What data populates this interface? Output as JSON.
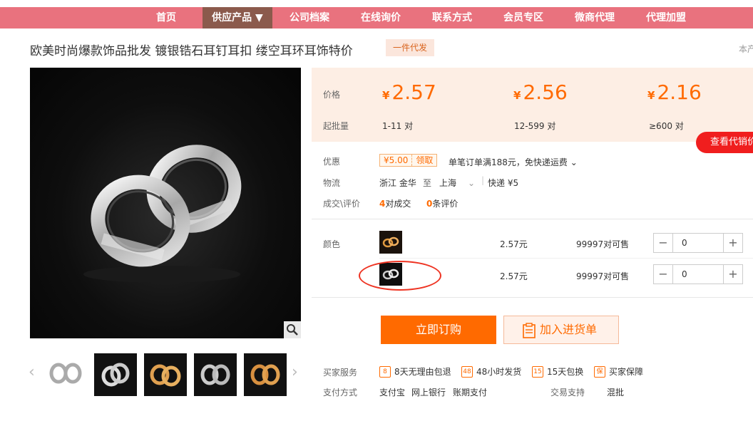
{
  "nav": [
    "首页",
    "供应产品 ▼",
    "公司档案",
    "在线询价",
    "联系方式",
    "会员专区",
    "微商代理",
    "代理加盟"
  ],
  "product": {
    "title": "欧美时尚爆款饰品批发 镀银锆石耳钉耳扣 缕空耳环耳饰特价",
    "badge": "一件代发",
    "corner_text": "本产"
  },
  "pricing": {
    "price_label": "价格",
    "min_label": "起批量",
    "currency": "¥",
    "tiers": [
      {
        "price": "2.57",
        "range": "1-11",
        "unit": "对"
      },
      {
        "price": "2.56",
        "range": "12-599",
        "unit": "对"
      },
      {
        "price": "2.16",
        "range": "≥600",
        "unit": "对"
      }
    ]
  },
  "agent_button": "查看代销价",
  "promo": {
    "label": "优惠",
    "coupon_amount": "¥5.00",
    "coupon_action": "领取",
    "text": "单笔订单满188元，免快递运费"
  },
  "logistics": {
    "label": "物流",
    "from": "浙江 金华",
    "to_word": "至",
    "to": "上海",
    "express": "快递 ¥5"
  },
  "deals": {
    "label": "成交\\评价",
    "count": "4",
    "count_text": "对成交",
    "reviews": "0",
    "reviews_text": "条评价"
  },
  "color_label": "颜色",
  "variants": [
    {
      "price": "2.57元",
      "stock": "99997对可售",
      "qty": "0"
    },
    {
      "price": "2.57元",
      "stock": "99997对可售",
      "qty": "0"
    }
  ],
  "buttons": {
    "buy": "立即订购",
    "cart": "加入进货单"
  },
  "services": {
    "label": "买家服务",
    "items": [
      "8天无理由包退",
      "48小时发货",
      "15天包换",
      "买家保障"
    ]
  },
  "payment": {
    "label": "支付方式",
    "methods": [
      "支付宝",
      "网上银行",
      "账期支付"
    ],
    "trade_label": "交易支持",
    "trade_value": "混批"
  },
  "colors": {
    "accent": "#ff6a00",
    "nav": "#e9727e",
    "nav_active": "#8b5a4c",
    "price_bg": "#fdeee4",
    "alert": "#f01e1e"
  },
  "icons": [
    "zoom-icon",
    "chevron-left-icon",
    "chevron-right-icon",
    "chevron-down-icon",
    "minus-icon",
    "plus-icon",
    "clipboard-icon"
  ]
}
